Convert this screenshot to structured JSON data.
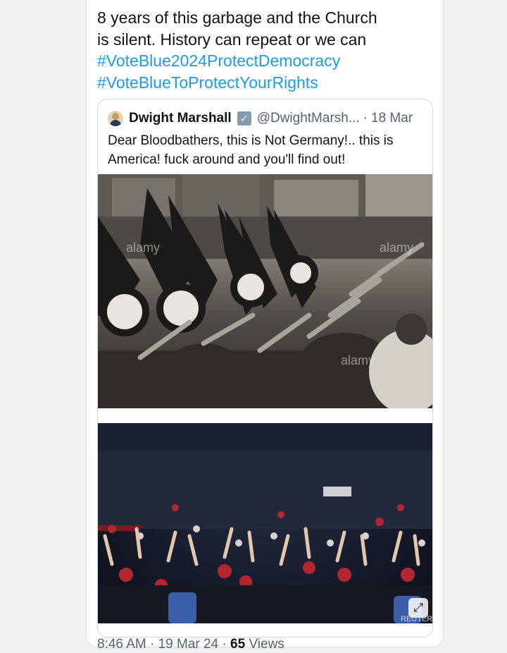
{
  "post": {
    "lines": [
      "8 years of this garbage and the Church",
      "is silent. History can repeat or we can"
    ],
    "hashtags": [
      "#VoteBlue2024ProtectDemocracy",
      "#VoteBlueToProtectYourRights"
    ]
  },
  "quote": {
    "name": "Dwight Marshall",
    "verified_glyph": "✓",
    "handle": "@DwightMarsh...",
    "dot": "·",
    "date": "18 Mar",
    "lines": [
      "Dear Bloodbathers, this is Not Germany!.. this is",
      "America! fuck around and you'll find out!"
    ],
    "media": [
      {
        "watermarks": [
          "alamy",
          "alamy",
          "alamy"
        ]
      },
      {
        "watermark": "REUTERS"
      }
    ],
    "expand_glyph": "⤢"
  },
  "meta": {
    "time": "8:46 AM",
    "sep1": "·",
    "date": "19 Mar 24",
    "sep2": "·",
    "views_count": "65",
    "views_label": "Views"
  },
  "colors": {
    "hashtag": "#1d9bf0",
    "verified": "#829aab",
    "secondary_text": "#536471"
  }
}
